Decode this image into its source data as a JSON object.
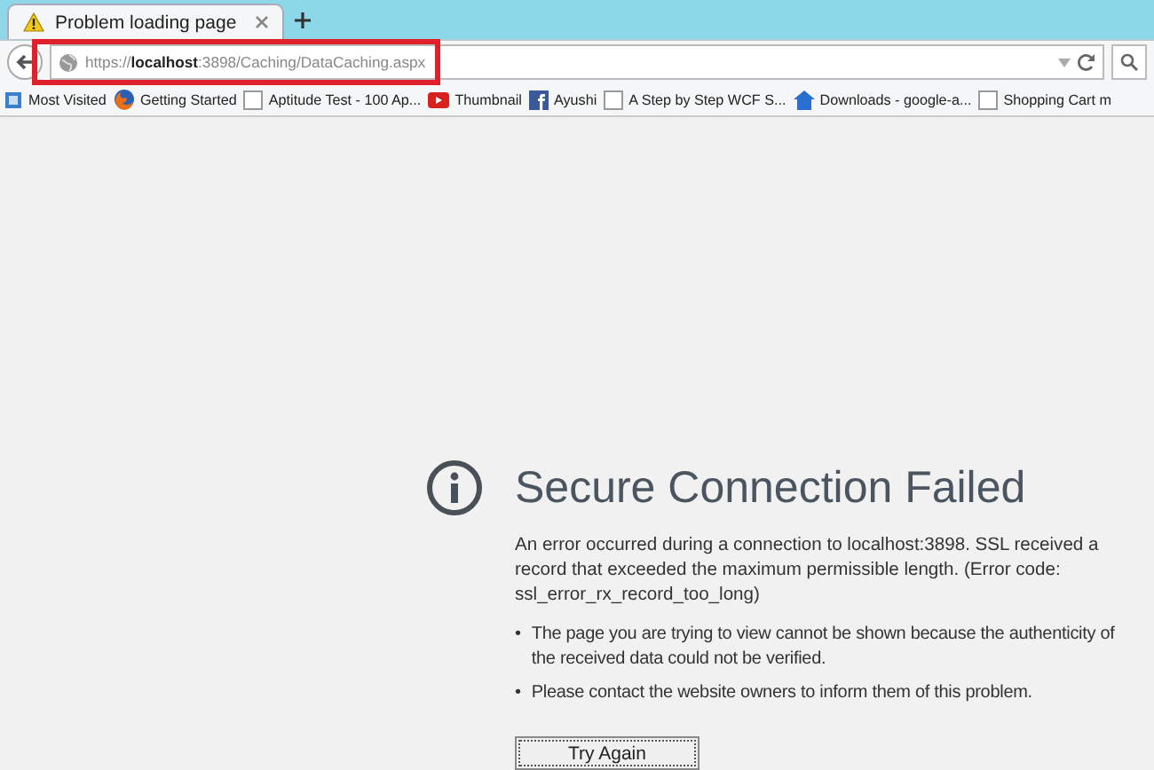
{
  "tab": {
    "title": "Problem loading page",
    "selected": true
  },
  "address_bar": {
    "url": "https://**localhost**:3898/Caching/DataCaching.aspx",
    "highlighted": true
  },
  "bookmarks": [
    {
      "label": "Most Visited",
      "kind": "page"
    },
    {
      "label": "Getting Started",
      "kind": "firefox"
    },
    {
      "label": "Aptitude Test - 100 Ap...",
      "kind": "blank"
    },
    {
      "label": "Thumbnail",
      "kind": "video"
    },
    {
      "label": "Ayushi",
      "kind": "facebook"
    },
    {
      "label": "A Step by Step WCF S...",
      "kind": "blank"
    },
    {
      "label": "Downloads - google-a...",
      "kind": "home"
    },
    {
      "label": "Shopping Cart m",
      "kind": "blank"
    }
  ],
  "error": {
    "title": "Secure Connection Failed",
    "message": "An error occurred during a connection to localhost:3898. SSL received a record that exceeded the maximum permissible length. (Error code: ssl_error_rx_record_too_long)",
    "bullets": [
      {
        "marker": "•",
        "text": "The page you are trying to view cannot be shown because the authenticity of the received data could not be verified."
      },
      {
        "marker": "•",
        "text": "Please contact the website owners to inform them of this problem."
      }
    ],
    "button": "Try Again"
  }
}
